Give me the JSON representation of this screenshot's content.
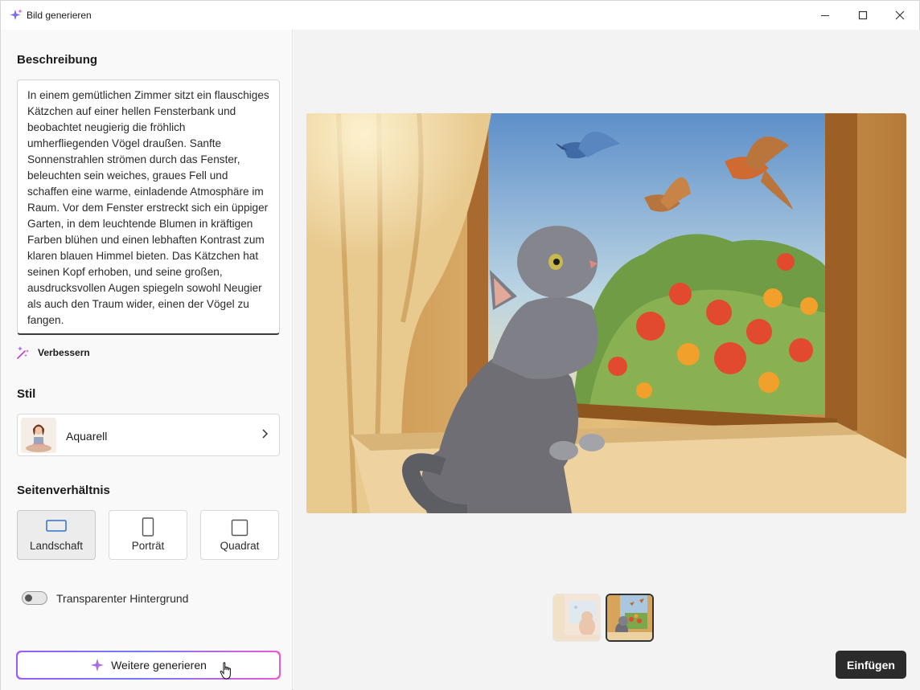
{
  "window": {
    "title": "Bild generieren",
    "icons": {
      "app": "sparkle-icon",
      "minimize": "minimize-icon",
      "maximize": "maximize-icon",
      "close": "close-icon"
    }
  },
  "description": {
    "heading": "Beschreibung",
    "text": "In einem gemütlichen Zimmer sitzt ein flauschiges Kätzchen auf einer hellen Fensterbank und beobachtet neugierig die fröhlich umherfliegenden Vögel draußen. Sanfte Sonnenstrahlen strömen durch das Fenster, beleuchten sein weiches, graues Fell und schaffen eine warme, einladende Atmosphäre im Raum. Vor dem Fenster erstreckt sich ein üppiger Garten, in dem leuchtende Blumen in kräftigen Farben blühen und einen lebhaften Kontrast zum klaren blauen Himmel bieten. Das Kätzchen hat seinen Kopf erhoben, und seine großen, ausdrucksvollen Augen spiegeln sowohl Neugier als auch den Traum wider, einen der Vögel zu fangen.",
    "improve_label": "Verbessern"
  },
  "style": {
    "heading": "Stil",
    "selected": "Aquarell"
  },
  "aspect": {
    "heading": "Seitenverhältnis",
    "options": [
      "Landschaft",
      "Porträt",
      "Quadrat"
    ],
    "selected": "Landschaft"
  },
  "transparent": {
    "label": "Transparenter Hintergrund",
    "enabled": false
  },
  "generate_more_label": "Weitere generieren",
  "insert_label": "Einfügen",
  "preview": {
    "thumbnail_count": 2,
    "selected_thumbnail": 2
  },
  "colors": {
    "accent_gradient": [
      "#9b5cf6",
      "#6f7bf7",
      "#e95ad1"
    ],
    "primary_button": "#2b2b2b",
    "selected_aspect_icon": "#2f6fd0"
  }
}
